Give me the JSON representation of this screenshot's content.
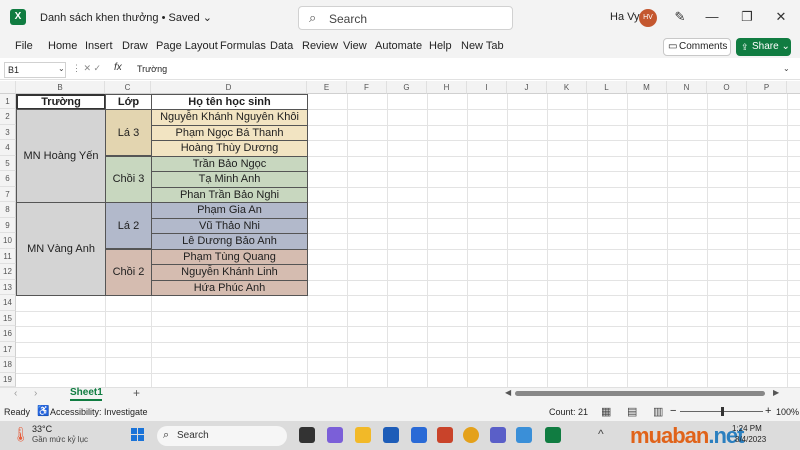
{
  "titlebar": {
    "doc_title": "Danh sách khen thưởng • Saved",
    "search_placeholder": "Search",
    "user_name": "Ha Vy",
    "avatar_initials": "HV"
  },
  "menu": [
    "File",
    "Home",
    "Insert",
    "Draw",
    "Page Layout",
    "Formulas",
    "Data",
    "Review",
    "View",
    "Automate",
    "Help",
    "New Tab"
  ],
  "actions": {
    "comments": "Comments",
    "share": "Share"
  },
  "formula_bar": {
    "name_box": "B1",
    "fx": "fx",
    "content": "Trường"
  },
  "grid": {
    "columns": [
      "B",
      "C",
      "D",
      "E",
      "F",
      "G",
      "H",
      "I",
      "J",
      "K",
      "L",
      "M",
      "N",
      "O",
      "P"
    ],
    "rows": [
      "1",
      "2",
      "3",
      "4",
      "5",
      "6",
      "7",
      "8",
      "9",
      "10",
      "11",
      "12",
      "13",
      "14",
      "15",
      "16",
      "17",
      "18",
      "19"
    ]
  },
  "table": {
    "headers": {
      "school": "Trường",
      "class": "Lớp",
      "name": "Họ tên học sinh"
    },
    "schools": [
      "MN Hoàng Yến",
      "MN Vàng Anh"
    ],
    "classes": [
      "Lá 3",
      "Chồi 3",
      "Lá 2",
      "Chồi 2"
    ],
    "students": [
      "Nguyễn Khánh Nguyên Khôi",
      "Phạm Ngọc Bá Thanh",
      "Hoàng Thùy Dương",
      "Trần Bảo Ngọc",
      "Tạ Minh Anh",
      "Phan Trần Bảo Nghi",
      "Phạm Gia An",
      "Vũ Thảo Nhi",
      "Lê Dương Bảo Anh",
      "Phạm Tùng Quang",
      "Nguyễn Khánh Linh",
      "Hứa Phúc Anh"
    ],
    "colors": {
      "school_fill": "#d4d4d4",
      "la3_class": "#e3d5b0",
      "la3_names": "#f2e4c2",
      "choi3": "#c8d7bf",
      "la2": "#b2b9cb",
      "choi2": "#d5bcb0"
    }
  },
  "sheet_tab": "Sheet1",
  "status": {
    "ready": "Ready",
    "accessibility": "Accessibility: Investigate",
    "count": "Count: 21",
    "zoom": "100%"
  },
  "taskbar": {
    "temp": "33°C",
    "weather": "Gần mức kỷ lục",
    "search": "Search",
    "time": "1:24 PM",
    "date": "8/4/2023"
  },
  "watermark": {
    "brand": "muaban",
    "tld": ".net"
  }
}
